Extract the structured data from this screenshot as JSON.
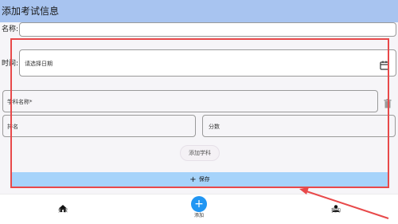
{
  "appbar": {
    "title": "添加考试信息"
  },
  "form": {
    "name_label": "名称:",
    "name_value": "",
    "time_label": "时间:",
    "date_placeholder": "请选择日期",
    "subject_name_placeholder": "学科名称*",
    "rank_placeholder": "排名",
    "score_placeholder": "分数",
    "add_subject_label": "添加学科",
    "save_label": "保存"
  },
  "icons": {
    "calendar": "calendar-icon",
    "delete": "trash-icon",
    "plus": "plus-icon",
    "home": "home-icon",
    "add": "add-icon",
    "person": "person-icon"
  },
  "bottom_nav": {
    "items": [
      {
        "label": "探索"
      },
      {
        "label": "添加"
      },
      {
        "label": "我的"
      }
    ]
  },
  "colors": {
    "appbar": "#a8c4f0",
    "save_bar": "#a6d3fa",
    "fab": "#2196f3",
    "highlight": "#e8494a"
  }
}
